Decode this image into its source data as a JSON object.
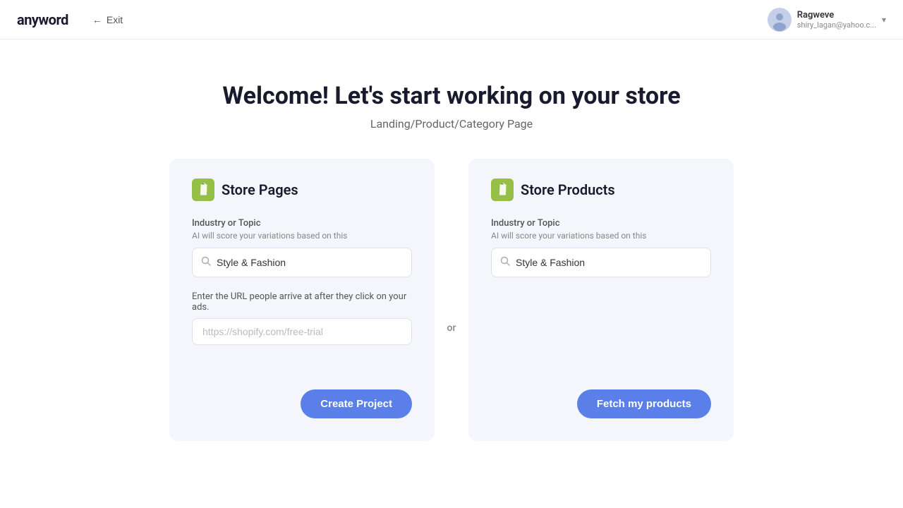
{
  "header": {
    "logo": "anyword",
    "exit_label": "Exit",
    "user": {
      "name": "Ragweve",
      "email": "shiry_lagan@yahoo.c..."
    }
  },
  "main": {
    "title": "Welcome! Let's start working on your store",
    "subtitle": "Landing/Product/Category Page",
    "or_divider": "or"
  },
  "store_pages_card": {
    "icon_alt": "shopify-pages-icon",
    "title": "Store Pages",
    "field_label": "Industry or Topic",
    "field_hint": "AI will score your variations based on this",
    "search_value": "Style & Fashion",
    "search_placeholder": "Style & Fashion",
    "url_label": "Enter the URL people arrive at after they click on your ads.",
    "url_placeholder": "https://shopify.com/free-trial",
    "create_button_label": "Create Project"
  },
  "store_products_card": {
    "icon_alt": "shopify-products-icon",
    "title": "Store Products",
    "field_label": "Industry or Topic",
    "field_hint": "AI will score your variations based on this",
    "search_value": "Style & Fashion",
    "search_placeholder": "Style & Fashion",
    "fetch_button_label": "Fetch my products"
  },
  "icons": {
    "search": "🔍",
    "exit_arrow": "←",
    "chevron_down": "▾"
  }
}
